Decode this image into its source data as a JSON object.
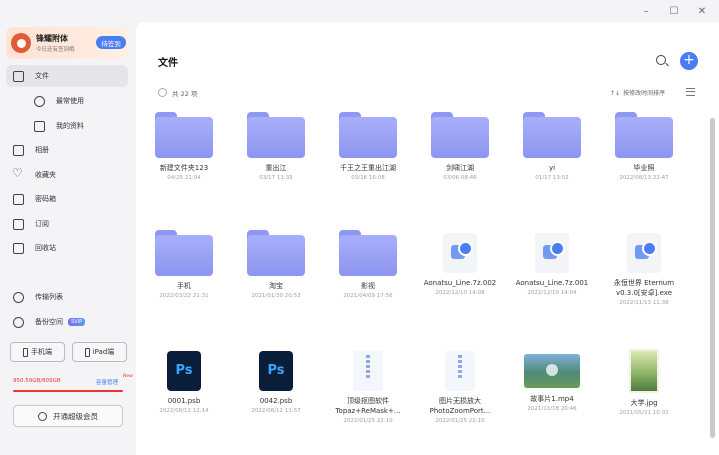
{
  "window": {
    "minimize": "–",
    "maximize": "☐",
    "close": "✕"
  },
  "user": {
    "name": "锋耀附体",
    "subtitle": "今日还有签到哦",
    "checkin": "待签到"
  },
  "nav": {
    "files": "文件",
    "recent": "最常使用",
    "my_data": "我的资料",
    "album": "相册",
    "favorites": "收藏夹",
    "password_box": "密码箱",
    "subscribe": "订阅",
    "recycle": "回收站",
    "transfer": "传输列表",
    "backup": "备份空间",
    "backup_badge": "SVIP"
  },
  "devices": {
    "phone": "手机端",
    "ipad": "iPad端"
  },
  "storage": {
    "used": "950.59GB/809GB",
    "manage": "容量管理",
    "new": "New",
    "fraction": 1.0
  },
  "upgrade": "开通超级会员",
  "main": {
    "title": "文件",
    "count": "共 22 项",
    "sort": "按修改时间排序"
  },
  "files": [
    {
      "name": "新建文件夹123",
      "date": "04/25 21:04",
      "kind": "folder"
    },
    {
      "name": "重出江",
      "date": "03/17 11:35",
      "kind": "folder"
    },
    {
      "name": "千王之王重出江湖",
      "date": "03/16 16:08",
      "kind": "folder"
    },
    {
      "name": "剑啸江湖",
      "date": "03/06 08:46",
      "kind": "folder"
    },
    {
      "name": "yi",
      "date": "01/17 13:02",
      "kind": "folder"
    },
    {
      "name": "毕业照",
      "date": "2022/08/13 22:47",
      "kind": "folder"
    },
    {
      "name": "手机",
      "date": "2022/03/22 21:31",
      "kind": "folder"
    },
    {
      "name": "淘宝",
      "date": "2021/01/30 20:53",
      "kind": "folder"
    },
    {
      "name": "影视",
      "date": "2021/04/09 17:56",
      "kind": "folder"
    },
    {
      "name": "Aonatsu_Line.7z.002",
      "date": "2022/12/10 14:08",
      "kind": "archive"
    },
    {
      "name": "Aonatsu_Line.7z.001",
      "date": "2022/12/10 14:04",
      "kind": "archive"
    },
    {
      "name": "永恒世界 Eternum v0.3.0[安卓].exe",
      "date": "2022/11/13 11:38",
      "kind": "archive"
    },
    {
      "name": "0001.psb",
      "date": "2022/08/12 12:14",
      "kind": "ps",
      "glyph": "Ps"
    },
    {
      "name": "0042.psb",
      "date": "2022/08/12 11:57",
      "kind": "ps",
      "glyph": "Ps"
    },
    {
      "name": "顶级抠图软件 Topaz+ReMask+...",
      "date": "2022/01/25 22:10",
      "kind": "zip"
    },
    {
      "name": "图片无损放大 PhotoZoomPort...",
      "date": "2022/01/25 22:10",
      "kind": "zip"
    },
    {
      "name": "故事片1.mp4",
      "date": "2021/11/18 20:46",
      "kind": "video"
    },
    {
      "name": "大学.jpg",
      "date": "2021/05/21 10:02",
      "kind": "image"
    }
  ]
}
